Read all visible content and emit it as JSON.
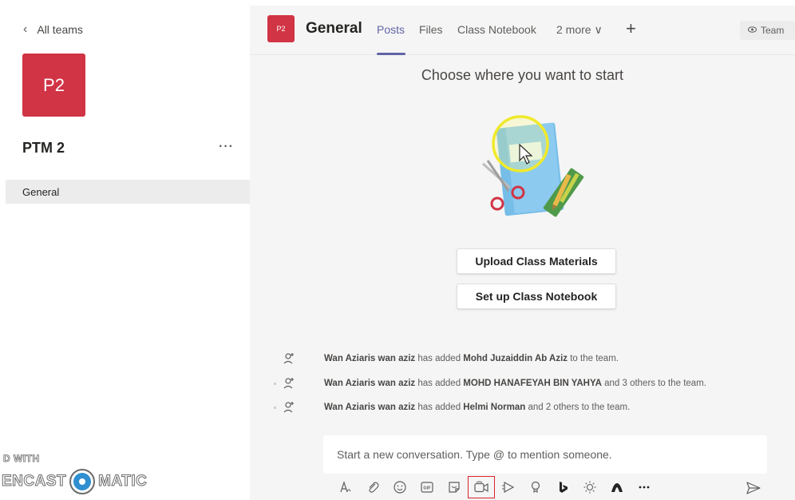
{
  "sidebar": {
    "back_label": "All teams",
    "team_avatar": "P2",
    "team_name": "PTM 2",
    "more_label": "···",
    "channels": [
      {
        "label": "General"
      }
    ]
  },
  "watermark": {
    "line1": "D WITH",
    "line2_left": "ENCAST",
    "line2_right": "MATIC"
  },
  "header": {
    "channel_avatar": "P2",
    "channel_name": "General",
    "tabs": [
      {
        "label": "Posts",
        "active": true
      },
      {
        "label": "Files"
      },
      {
        "label": "Class Notebook"
      },
      {
        "label": "2 more ∨"
      }
    ],
    "add_tab": "+",
    "team_button": "Team"
  },
  "main": {
    "prompt": "Choose where you want to start",
    "buttons": {
      "upload": "Upload Class Materials",
      "notebook": "Set up Class Notebook"
    },
    "activity": [
      {
        "actor": "Wan Aziaris wan aziz",
        "mid": " has added ",
        "target": "Mohd Juzaiddin Ab Aziz",
        "tail": " to the team."
      },
      {
        "actor": "Wan Aziaris wan aziz",
        "mid": " has added ",
        "target": "MOHD HANAFEYAH BIN YAHYA",
        "tail": " and 3 others to the team."
      },
      {
        "actor": "Wan Aziaris wan aziz",
        "mid": " has added ",
        "target": "Helmi Norman",
        "tail": " and 2 others to the team."
      }
    ]
  },
  "compose": {
    "placeholder": "Start a new conversation. Type @ to mention someone.",
    "tools": [
      "format-icon",
      "attach-icon",
      "emoji-icon",
      "gif-icon",
      "sticker-icon",
      "meet-now-icon",
      "stream-icon",
      "praise-icon",
      "bing-icon",
      "weather-icon",
      "app-icon",
      "more-icon"
    ],
    "highlighted_tool": "meet-now-icon"
  },
  "colors": {
    "accent": "#6264a7",
    "avatar": "#d13445",
    "highlight": "#d9252b"
  }
}
